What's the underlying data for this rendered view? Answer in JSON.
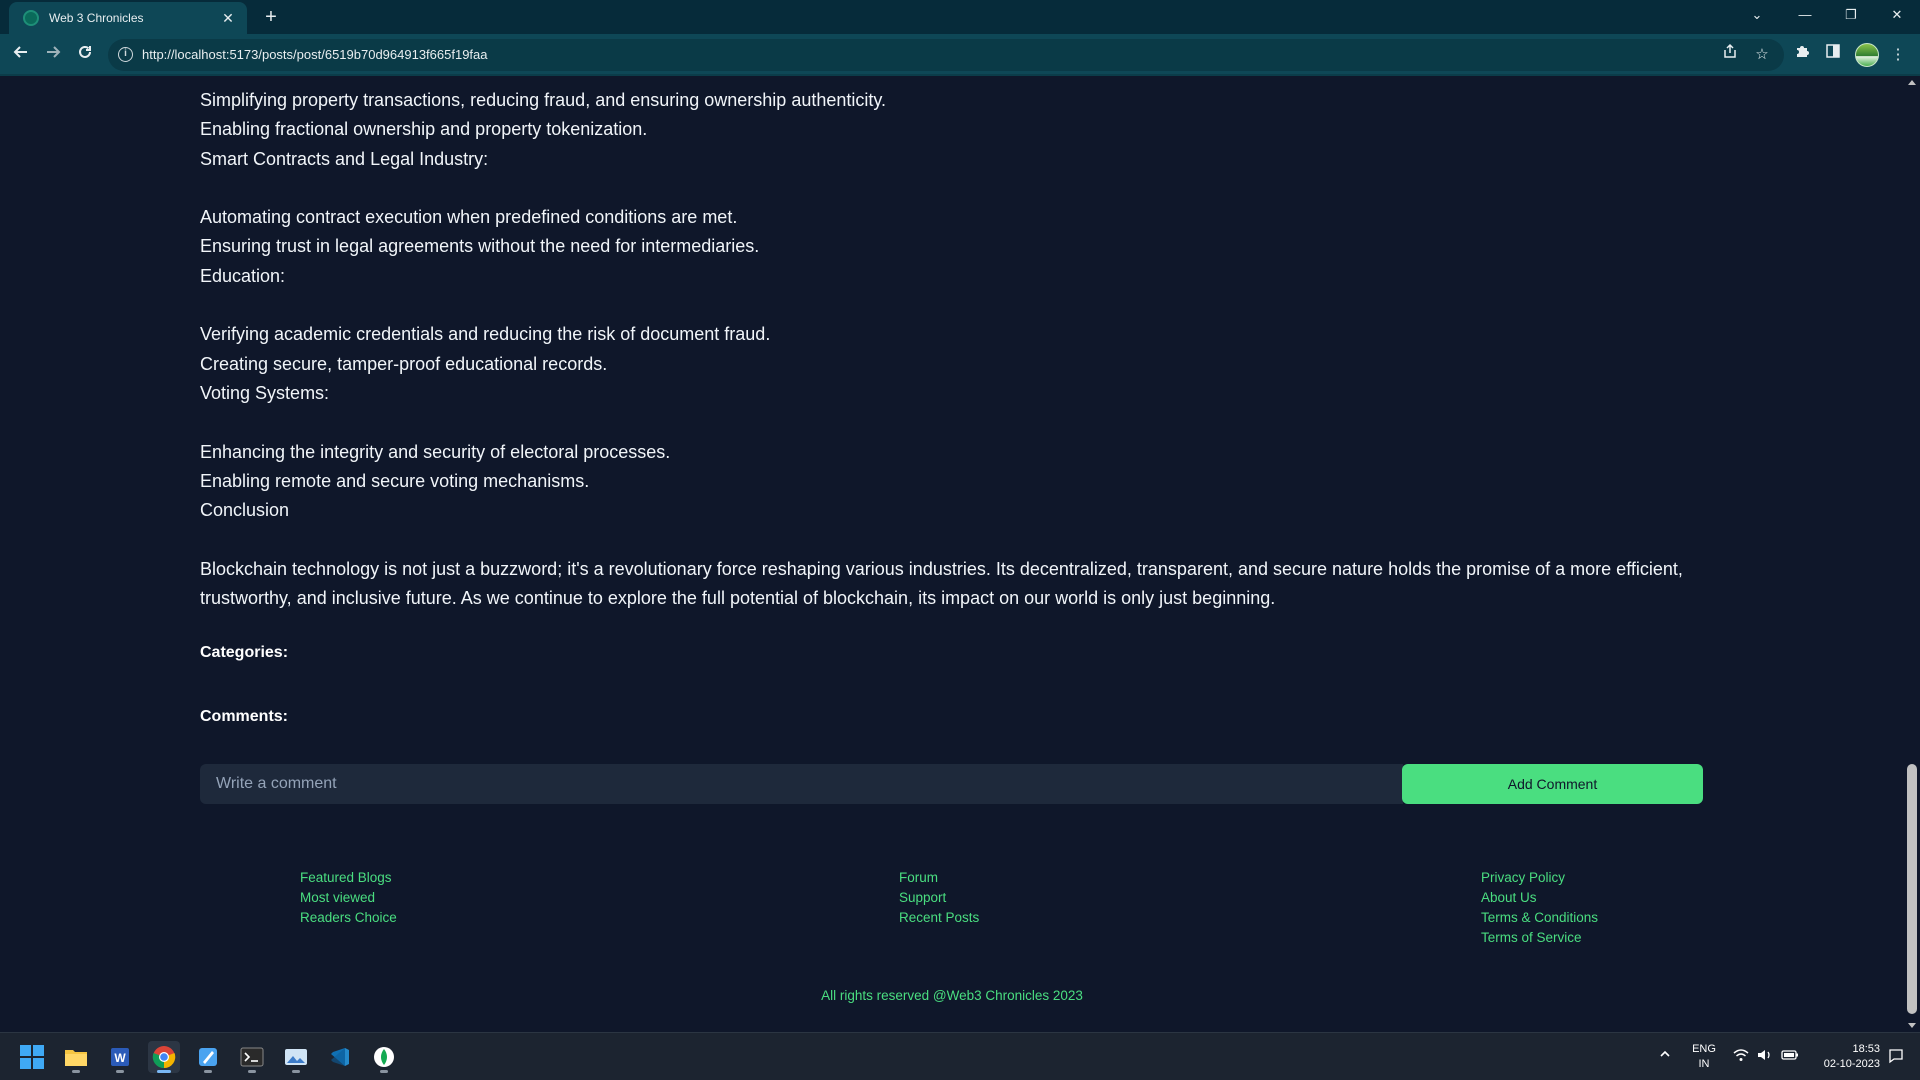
{
  "browser": {
    "tab_title": "Web 3 Chronicles",
    "tab_close": "✕",
    "new_tab": "+",
    "url": "http://localhost:5173/posts/post/6519b70d964913f665f19faa",
    "window_controls": {
      "dropdown": "⌄",
      "minimize": "—",
      "restore": "❐",
      "close": "✕"
    }
  },
  "article": {
    "lines": [
      "Simplifying property transactions, reducing fraud, and ensuring ownership authenticity.",
      "Enabling fractional ownership and property tokenization.",
      "Smart Contracts and Legal Industry:",
      "",
      "Automating contract execution when predefined conditions are met.",
      "Ensuring trust in legal agreements without the need for intermediaries.",
      "Education:",
      "",
      "Verifying academic credentials and reducing the risk of document fraud.",
      "Creating secure, tamper-proof educational records.",
      "Voting Systems:",
      "",
      "Enhancing the integrity and security of electoral processes.",
      "Enabling remote and secure voting mechanisms.",
      "Conclusion",
      "",
      "Blockchain technology is not just a buzzword; it's a revolutionary force reshaping various industries. Its decentralized, transparent, and secure nature holds the promise of a more efficient, trustworthy, and inclusive future. As we continue to explore the full potential of blockchain, its impact on our world is only just beginning."
    ],
    "categories_label": "Categories:",
    "comments_label": "Comments:"
  },
  "comment_form": {
    "placeholder": "Write a comment",
    "button_label": "Add Comment"
  },
  "footer": {
    "col1": [
      "Featured Blogs",
      "Most viewed",
      "Readers Choice"
    ],
    "col2": [
      "Forum",
      "Support",
      "Recent Posts"
    ],
    "col3": [
      "Privacy Policy",
      "About Us",
      "Terms & Conditions",
      "Terms of Service"
    ],
    "copyright": "All rights reserved @Web3 Chronicles 2023"
  },
  "taskbar": {
    "apps": [
      "start-icon",
      "file-explorer-icon",
      "word-icon",
      "chrome-icon",
      "paint-icon",
      "terminal-icon",
      "photos-icon",
      "vscode-icon",
      "mongodb-compass-icon"
    ],
    "language_line1": "ENG",
    "language_line2": "IN",
    "time": "18:53",
    "date": "02-10-2023"
  },
  "colors": {
    "page_bg": "#0f172a",
    "accent": "#4ade80",
    "text": "#f1f5f9",
    "chrome_bg": "#0e4756"
  }
}
